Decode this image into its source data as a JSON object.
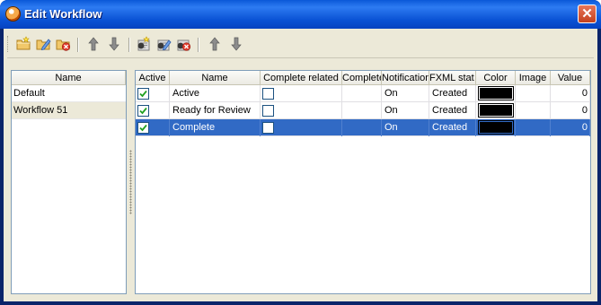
{
  "window": {
    "title": "Edit Workflow",
    "close_glyph": "✕"
  },
  "colors": {
    "title_bar": "#0a52d4",
    "selection": "#316ac5",
    "panel_bg": "#ece9d8",
    "border": "#7f9db9"
  },
  "toolbar": {
    "buttons": [
      {
        "name": "new-workflow-icon"
      },
      {
        "name": "edit-workflow-icon"
      },
      {
        "name": "delete-workflow-icon"
      },
      {
        "name": "move-up-icon"
      },
      {
        "name": "move-down-icon"
      },
      {
        "name": "new-status-icon"
      },
      {
        "name": "edit-status-icon"
      },
      {
        "name": "delete-status-icon"
      },
      {
        "name": "move-status-up-icon"
      },
      {
        "name": "move-status-down-icon"
      }
    ]
  },
  "workflows": {
    "header": "Name",
    "items": [
      {
        "label": "Default",
        "selected": false
      },
      {
        "label": "Workflow 51",
        "selected": true
      }
    ]
  },
  "statuses": {
    "columns": {
      "active": "Active",
      "name": "Name",
      "complete_related": "Complete related",
      "complete": "Complete",
      "notification": "Notification",
      "xml_stat": "FXML stat",
      "color": "Color",
      "image": "Image",
      "value": "Value"
    },
    "rows": [
      {
        "active": true,
        "name": "Active",
        "complete_related": false,
        "complete": "",
        "notification": "On",
        "xml_stat": "Created",
        "color": "#000000",
        "image": "",
        "value": "0",
        "selected": false
      },
      {
        "active": true,
        "name": "Ready for Review",
        "complete_related": false,
        "complete": "",
        "notification": "On",
        "xml_stat": "Created",
        "color": "#000000",
        "image": "",
        "value": "0",
        "selected": false
      },
      {
        "active": true,
        "name": "Complete",
        "complete_related": false,
        "complete": "",
        "notification": "On",
        "xml_stat": "Created",
        "color": "#000000",
        "image": "",
        "value": "0",
        "selected": true
      }
    ]
  }
}
